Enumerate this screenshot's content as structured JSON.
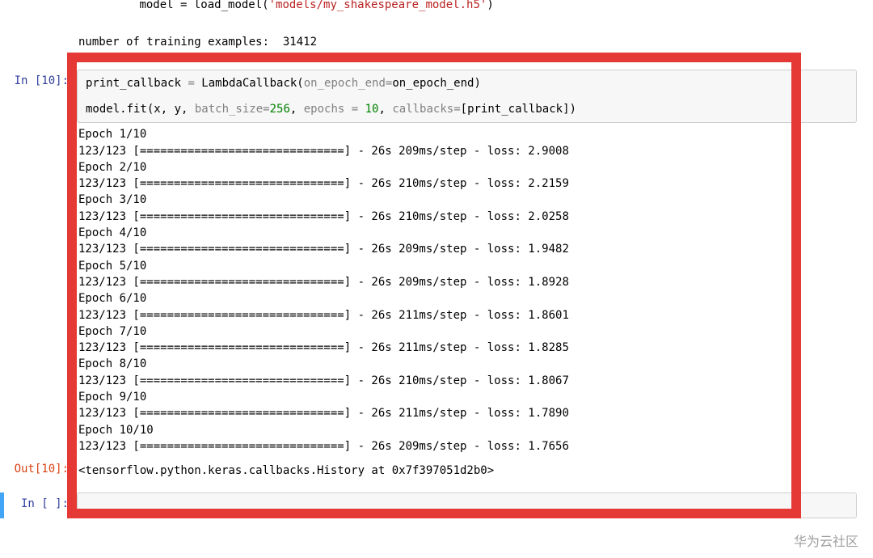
{
  "cell_prev": {
    "code_tail_plain": "model = load_model(",
    "code_tail_str": "'models/my_shakespeare_model.h5'",
    "code_tail_close": ")",
    "output": "number of training examples:  31412"
  },
  "cell_main": {
    "prompt": "In [10]:",
    "code": {
      "l1_a": "print_callback ",
      "l1_eq": "=",
      "l1_b": " LambdaCallback(",
      "l1_kw1": "on_epoch_end",
      "l1_eq2": "=",
      "l1_c": "on_epoch_end)",
      "l2": "",
      "l3_a": "model.fit(x, y, ",
      "l3_kw1": "batch_size",
      "l3_eq1": "=",
      "l3_v1": "256",
      "l3_b": ", ",
      "l3_kw2": "epochs",
      "l3_eq2": " = ",
      "l3_v2": "10",
      "l3_c": ", ",
      "l3_kw3": "callbacks",
      "l3_eq3": "=",
      "l3_d": "[print_callback])"
    },
    "epochs": [
      {
        "label": "Epoch 1/10",
        "bar": "123/123 [==============================] - 26s 209ms/step - loss: 2.9008"
      },
      {
        "label": "Epoch 2/10",
        "bar": "123/123 [==============================] - 26s 210ms/step - loss: 2.2159"
      },
      {
        "label": "Epoch 3/10",
        "bar": "123/123 [==============================] - 26s 210ms/step - loss: 2.0258"
      },
      {
        "label": "Epoch 4/10",
        "bar": "123/123 [==============================] - 26s 209ms/step - loss: 1.9482"
      },
      {
        "label": "Epoch 5/10",
        "bar": "123/123 [==============================] - 26s 209ms/step - loss: 1.8928"
      },
      {
        "label": "Epoch 6/10",
        "bar": "123/123 [==============================] - 26s 211ms/step - loss: 1.8601"
      },
      {
        "label": "Epoch 7/10",
        "bar": "123/123 [==============================] - 26s 211ms/step - loss: 1.8285"
      },
      {
        "label": "Epoch 8/10",
        "bar": "123/123 [==============================] - 26s 210ms/step - loss: 1.8067"
      },
      {
        "label": "Epoch 9/10",
        "bar": "123/123 [==============================] - 26s 211ms/step - loss: 1.7890"
      },
      {
        "label": "Epoch 10/10",
        "bar": "123/123 [==============================] - 26s 209ms/step - loss: 1.7656"
      }
    ],
    "out_prompt": "Out[10]:",
    "out_text": "<tensorflow.python.keras.callbacks.History at 0x7f397051d2b0>"
  },
  "cell_next": {
    "prompt": "In [ ]:",
    "code": ""
  },
  "watermark": "华为云社区"
}
